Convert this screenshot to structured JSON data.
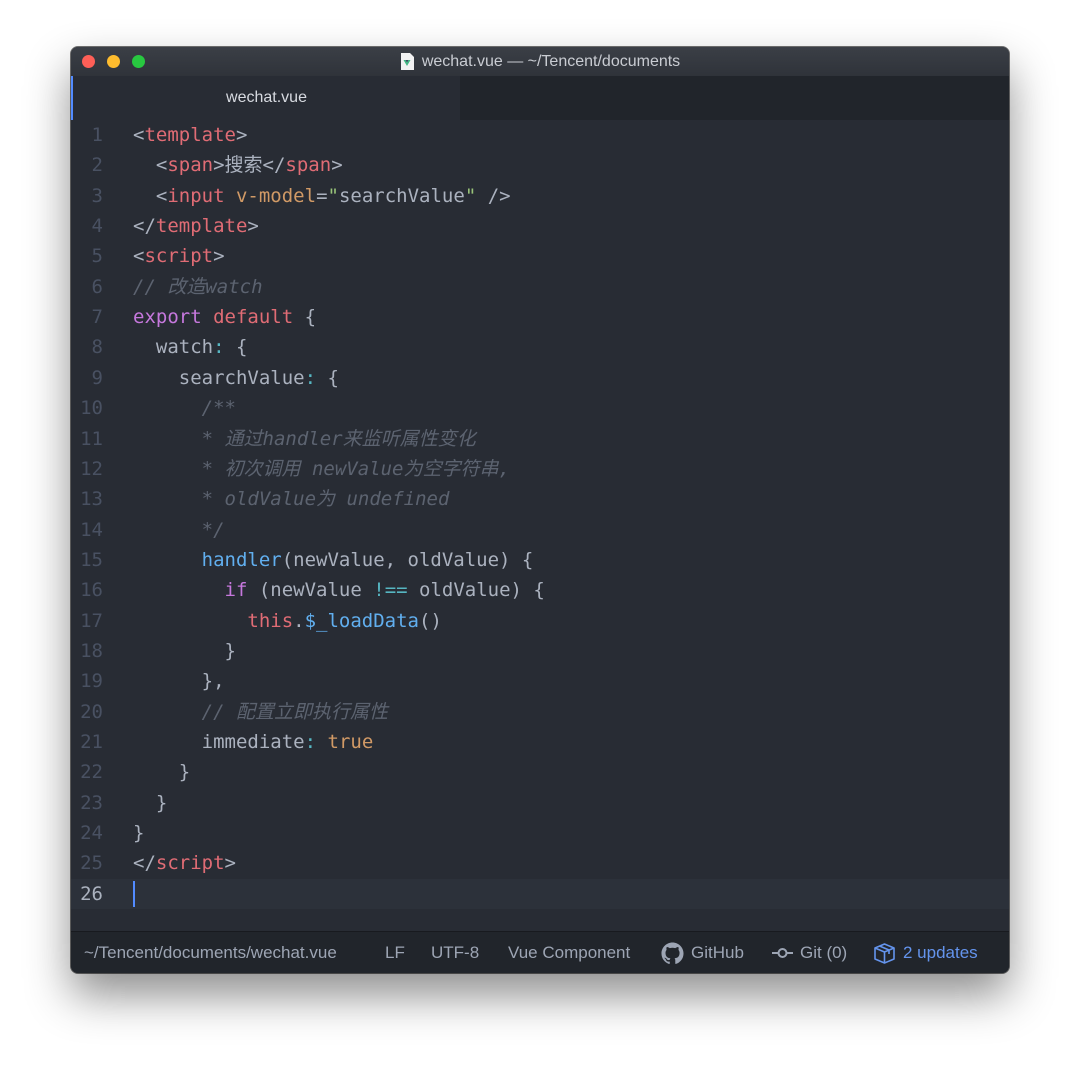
{
  "window": {
    "title": "wechat.vue — ~/Tencent/documents",
    "tab_label": "wechat.vue"
  },
  "colors": {
    "tag": "#e06c75",
    "attribute": "#d19a66",
    "string": "#98c379",
    "comment": "#5c6370",
    "keyword": "#c678dd",
    "operator": "#56b6c2",
    "function": "#61afef",
    "literal": "#d19a66",
    "accent": "#528bff",
    "updates": "#6494ed"
  },
  "editor": {
    "active_line": 26,
    "lines": [
      {
        "n": "1",
        "tokens": [
          {
            "t": "<",
            "c": "p"
          },
          {
            "t": "template",
            "c": "tag"
          },
          {
            "t": ">",
            "c": "p"
          }
        ]
      },
      {
        "n": "2",
        "tokens": [
          {
            "t": "  <",
            "c": "p"
          },
          {
            "t": "span",
            "c": "tag"
          },
          {
            "t": ">搜索</",
            "c": "p"
          },
          {
            "t": "span",
            "c": "tag"
          },
          {
            "t": ">",
            "c": "p"
          }
        ]
      },
      {
        "n": "3",
        "tokens": [
          {
            "t": "  <",
            "c": "p"
          },
          {
            "t": "input",
            "c": "tag"
          },
          {
            "t": " ",
            "c": "p"
          },
          {
            "t": "v-model",
            "c": "attr"
          },
          {
            "t": "=",
            "c": "p"
          },
          {
            "t": "\"",
            "c": "str"
          },
          {
            "t": "searchValue",
            "c": "p"
          },
          {
            "t": "\"",
            "c": "str"
          },
          {
            "t": " />",
            "c": "p"
          }
        ]
      },
      {
        "n": "4",
        "tokens": [
          {
            "t": "</",
            "c": "p"
          },
          {
            "t": "template",
            "c": "tag"
          },
          {
            "t": ">",
            "c": "p"
          }
        ]
      },
      {
        "n": "5",
        "tokens": [
          {
            "t": "<",
            "c": "p"
          },
          {
            "t": "script",
            "c": "tag"
          },
          {
            "t": ">",
            "c": "p"
          }
        ]
      },
      {
        "n": "6",
        "tokens": [
          {
            "t": "// 改造watch",
            "c": "com"
          }
        ]
      },
      {
        "n": "7",
        "tokens": [
          {
            "t": "export",
            "c": "key"
          },
          {
            "t": " ",
            "c": "p"
          },
          {
            "t": "default",
            "c": "tag"
          },
          {
            "t": " {",
            "c": "p"
          }
        ]
      },
      {
        "n": "8",
        "tokens": [
          {
            "t": "  watch",
            "c": "p"
          },
          {
            "t": ":",
            "c": "op"
          },
          {
            "t": " {",
            "c": "p"
          }
        ]
      },
      {
        "n": "9",
        "tokens": [
          {
            "t": "    searchValue",
            "c": "p"
          },
          {
            "t": ":",
            "c": "op"
          },
          {
            "t": " {",
            "c": "p"
          }
        ]
      },
      {
        "n": "10",
        "tokens": [
          {
            "t": "      /**",
            "c": "com"
          }
        ]
      },
      {
        "n": "11",
        "tokens": [
          {
            "t": "      * 通过handler来监听属性变化",
            "c": "com"
          }
        ]
      },
      {
        "n": "12",
        "tokens": [
          {
            "t": "      * 初次调用 newValue为空字符串,",
            "c": "com"
          }
        ]
      },
      {
        "n": "13",
        "tokens": [
          {
            "t": "      * oldValue为 undefined",
            "c": "com"
          }
        ]
      },
      {
        "n": "14",
        "tokens": [
          {
            "t": "      */",
            "c": "com"
          }
        ]
      },
      {
        "n": "15",
        "tokens": [
          {
            "t": "      ",
            "c": "p"
          },
          {
            "t": "handler",
            "c": "fn"
          },
          {
            "t": "(newValue, oldValue) {",
            "c": "p"
          }
        ]
      },
      {
        "n": "16",
        "tokens": [
          {
            "t": "        ",
            "c": "p"
          },
          {
            "t": "if",
            "c": "key"
          },
          {
            "t": " (newValue ",
            "c": "p"
          },
          {
            "t": "!==",
            "c": "op"
          },
          {
            "t": " oldValue) {",
            "c": "p"
          }
        ]
      },
      {
        "n": "17",
        "tokens": [
          {
            "t": "          ",
            "c": "p"
          },
          {
            "t": "this",
            "c": "this"
          },
          {
            "t": ".",
            "c": "p"
          },
          {
            "t": "$_loadData",
            "c": "fn"
          },
          {
            "t": "()",
            "c": "p"
          }
        ]
      },
      {
        "n": "18",
        "tokens": [
          {
            "t": "        }",
            "c": "p"
          }
        ]
      },
      {
        "n": "19",
        "tokens": [
          {
            "t": "      },",
            "c": "p"
          }
        ]
      },
      {
        "n": "20",
        "tokens": [
          {
            "t": "      // 配置立即执行属性",
            "c": "com"
          }
        ]
      },
      {
        "n": "21",
        "tokens": [
          {
            "t": "      immediate",
            "c": "p"
          },
          {
            "t": ":",
            "c": "op"
          },
          {
            "t": " ",
            "c": "p"
          },
          {
            "t": "true",
            "c": "lit"
          }
        ]
      },
      {
        "n": "22",
        "tokens": [
          {
            "t": "    }",
            "c": "p"
          }
        ]
      },
      {
        "n": "23",
        "tokens": [
          {
            "t": "  }",
            "c": "p"
          }
        ]
      },
      {
        "n": "24",
        "tokens": [
          {
            "t": "}",
            "c": "p"
          }
        ]
      },
      {
        "n": "25",
        "tokens": [
          {
            "t": "</",
            "c": "p"
          },
          {
            "t": "script",
            "c": "tag"
          },
          {
            "t": ">",
            "c": "p"
          }
        ]
      },
      {
        "n": "26",
        "tokens": []
      }
    ]
  },
  "statusbar": {
    "path": "~/Tencent/documents/wechat.vue",
    "line_ending": "LF",
    "encoding": "UTF-8",
    "grammar": "Vue Component",
    "github": "GitHub",
    "git": "Git (0)",
    "updates": "2 updates"
  },
  "icons": [
    "vue-file-icon",
    "github-icon",
    "git-commit-icon",
    "package-icon"
  ]
}
